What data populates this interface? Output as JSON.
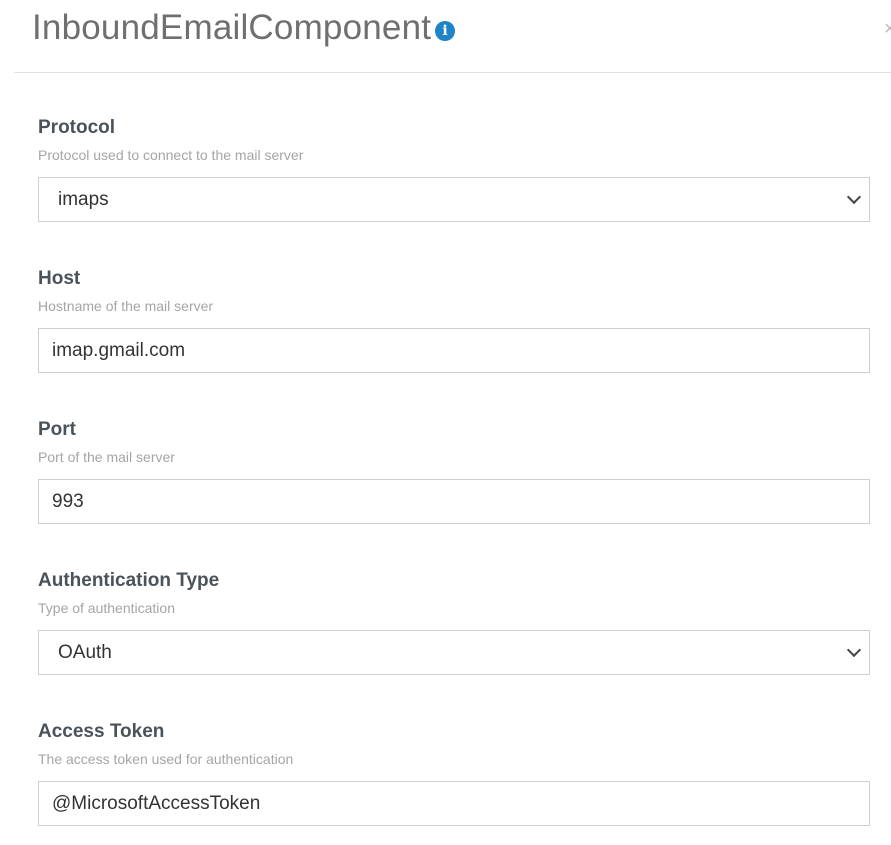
{
  "dialog": {
    "title": "InboundEmailComponent",
    "info_icon": "info-circle-icon",
    "close_icon": "close-icon"
  },
  "fields": {
    "protocol": {
      "label": "Protocol",
      "hint": "Protocol used to connect to the mail server",
      "value": "imaps"
    },
    "host": {
      "label": "Host",
      "hint": "Hostname of the mail server",
      "value": "imap.gmail.com"
    },
    "port": {
      "label": "Port",
      "hint": "Port of the mail server",
      "value": "993"
    },
    "auth_type": {
      "label": "Authentication Type",
      "hint": "Type of authentication",
      "value": "OAuth"
    },
    "access_token": {
      "label": "Access Token",
      "hint": "The access token used for authentication",
      "value": "@MicrosoftAccessToken"
    }
  },
  "colors": {
    "accent": "#1f83c6",
    "label": "#4a5359",
    "hint": "#a5a5a5",
    "border": "#cfcfcf"
  }
}
